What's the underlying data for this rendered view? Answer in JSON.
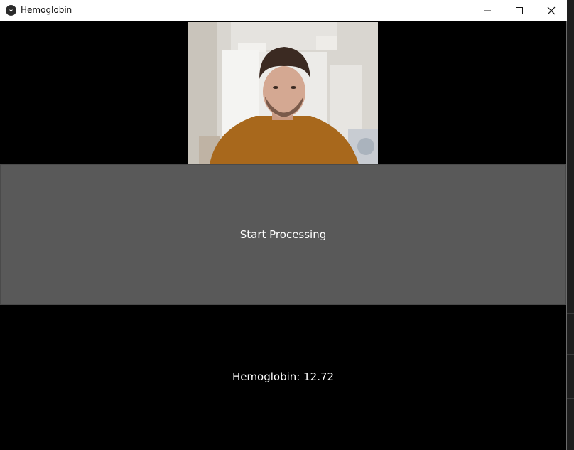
{
  "window": {
    "title": "Hemoglobin",
    "controls": [
      "minimize-icon",
      "maximize-icon",
      "close-icon"
    ]
  },
  "camera_feed": {
    "description_icon": "webcam-feed"
  },
  "start_button": {
    "label": "Start Processing"
  },
  "result": {
    "label": "Hemoglobin: 12.72"
  },
  "colors": {
    "button_bg": "#595959",
    "window_bg": "#000000",
    "titlebar_bg": "#ffffff"
  }
}
